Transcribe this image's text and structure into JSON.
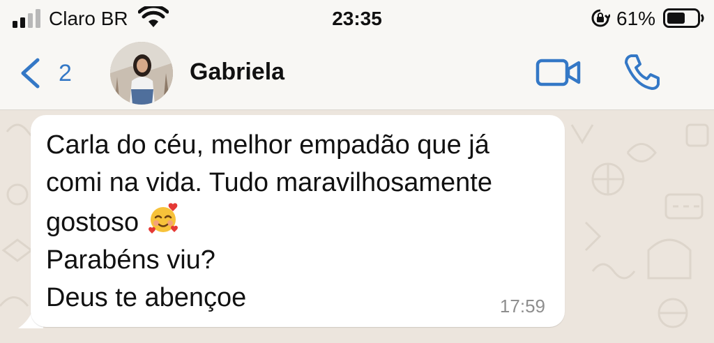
{
  "status_bar": {
    "carrier": "Claro BR",
    "time": "23:35",
    "battery_percent": "61%",
    "signal_bars": 2,
    "battery_level": 0.61
  },
  "header": {
    "back_count": "2",
    "contact_name": "Gabriela",
    "accent_color": "#3478c6"
  },
  "message": {
    "text_before_emoji": "Carla do céu, melhor empadão que já\ncomi na vida. Tudo maravilhosamente\ngostoso ",
    "emoji": "smiling-face-with-hearts-emoji",
    "text_after_emoji": "\nParabéns viu?\nDeus te abençoe",
    "time": "17:59"
  }
}
